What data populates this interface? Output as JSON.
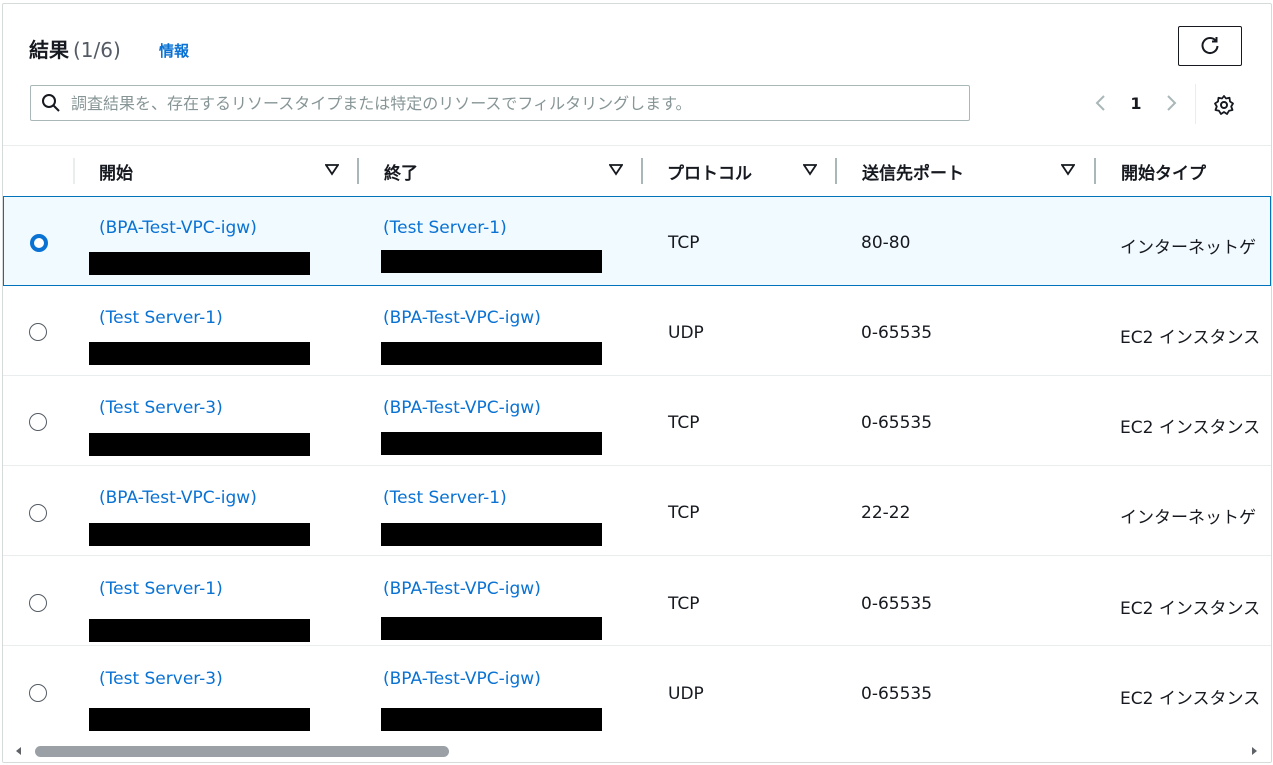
{
  "header": {
    "title": "結果",
    "count": "(1/6)",
    "info_link": "情報"
  },
  "search": {
    "placeholder": "調査結果を、存在するリソースタイプまたは特定のリソースでフィルタリングします。",
    "value": ""
  },
  "pagination": {
    "current_page": "1"
  },
  "columns": [
    "開始",
    "終了",
    "プロトコル",
    "送信先ポート",
    "開始タイプ"
  ],
  "rows": [
    {
      "selected": true,
      "start": "(BPA-Test-VPC-igw)",
      "end": "(Test Server-1)",
      "protocol": "TCP",
      "port": "80-80",
      "start_type": "インターネットゲ"
    },
    {
      "selected": false,
      "start": "(Test Server-1)",
      "end": "(BPA-Test-VPC-igw)",
      "protocol": "UDP",
      "port": "0-65535",
      "start_type": "EC2 インスタンス"
    },
    {
      "selected": false,
      "start": "(Test Server-3)",
      "end": "(BPA-Test-VPC-igw)",
      "protocol": "TCP",
      "port": "0-65535",
      "start_type": "EC2 インスタンス"
    },
    {
      "selected": false,
      "start": "(BPA-Test-VPC-igw)",
      "end": "(Test Server-1)",
      "protocol": "TCP",
      "port": "22-22",
      "start_type": "インターネットゲ"
    },
    {
      "selected": false,
      "start": "(Test Server-1)",
      "end": "(BPA-Test-VPC-igw)",
      "protocol": "TCP",
      "port": "0-65535",
      "start_type": "EC2 インスタンス"
    },
    {
      "selected": false,
      "start": "(Test Server-3)",
      "end": "(BPA-Test-VPC-igw)",
      "protocol": "UDP",
      "port": "0-65535",
      "start_type": "EC2 インスタンス"
    }
  ],
  "icons": {
    "refresh": "refresh-icon",
    "search": "search-icon",
    "prev": "chevron-left-icon",
    "next": "chevron-right-icon",
    "settings": "gear-icon",
    "sort": "sort-down-icon"
  },
  "colors": {
    "link": "#0972d3",
    "selected_bg": "#f1faff",
    "selected_border": "#0073bb",
    "redaction": "#000000"
  }
}
